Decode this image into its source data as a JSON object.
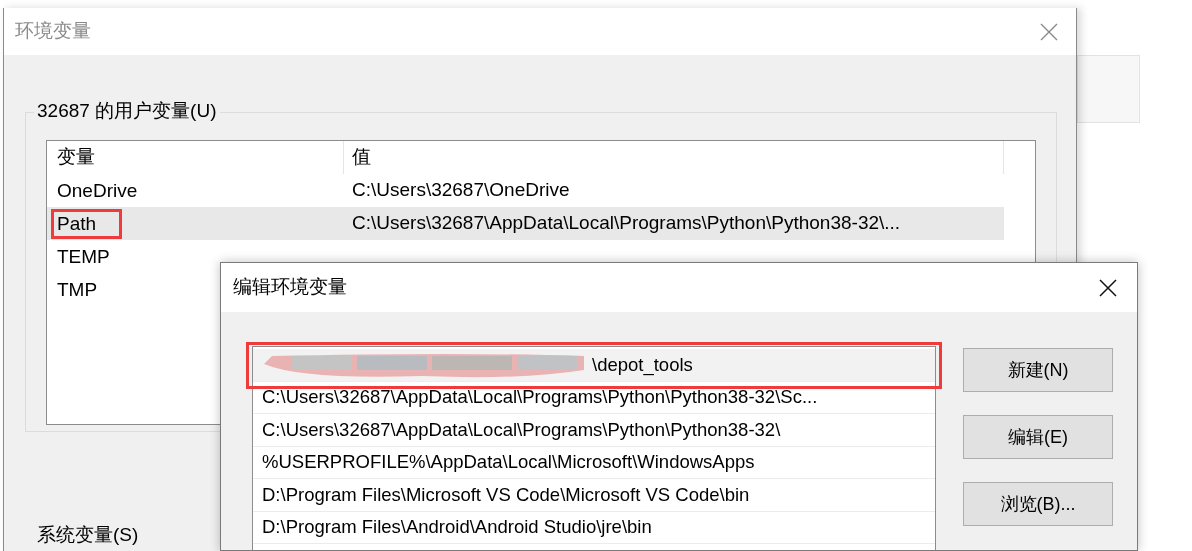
{
  "back_window": {
    "title": "环境变量",
    "user_group": {
      "label": "32687 的用户变量(U)",
      "columns": [
        "变量",
        "值"
      ],
      "rows": [
        {
          "name": "OneDrive",
          "value": "C:\\Users\\32687\\OneDrive",
          "selected": false,
          "highlighted": false
        },
        {
          "name": "Path",
          "value": "C:\\Users\\32687\\AppData\\Local\\Programs\\Python\\Python38-32\\...",
          "selected": true,
          "highlighted": true
        },
        {
          "name": "TEMP",
          "selected": false,
          "highlighted": false
        },
        {
          "name": "TMP",
          "selected": false,
          "highlighted": false
        }
      ]
    },
    "system_group": {
      "label": "系统变量(S)"
    }
  },
  "dialog": {
    "title": "编辑环境变量",
    "entries": [
      {
        "text": "\\depot_tools",
        "redacted": true,
        "selected": true,
        "highlighted": true
      },
      {
        "text": "C:\\Users\\32687\\AppData\\Local\\Programs\\Python\\Python38-32\\Sc...",
        "redacted": false,
        "selected": false,
        "highlighted": false
      },
      {
        "text": "C:\\Users\\32687\\AppData\\Local\\Programs\\Python\\Python38-32\\",
        "redacted": false,
        "selected": false,
        "highlighted": false
      },
      {
        "text": "%USERPROFILE%\\AppData\\Local\\Microsoft\\WindowsApps",
        "redacted": false,
        "selected": false,
        "highlighted": false
      },
      {
        "text": "D:\\Program Files\\Microsoft VS Code\\Microsoft VS Code\\bin",
        "redacted": false,
        "selected": false,
        "highlighted": false
      },
      {
        "text": "D:\\Program Files\\Android\\Android Studio\\jre\\bin",
        "redacted": false,
        "selected": false,
        "highlighted": false
      }
    ],
    "buttons": [
      "新建(N)",
      "编辑(E)",
      "浏览(B)..."
    ]
  }
}
